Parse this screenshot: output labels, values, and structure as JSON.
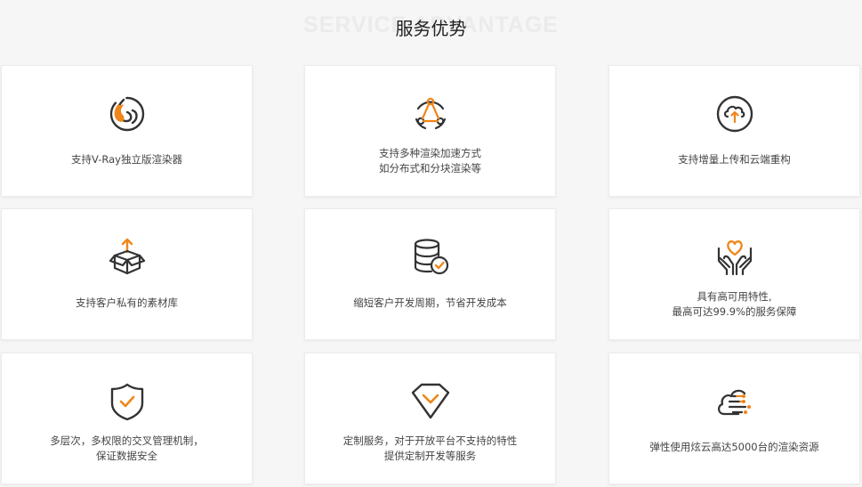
{
  "header": {
    "title": "服务优势",
    "bg_title": "SERVICE ADVANTAGE"
  },
  "colors": {
    "accent": "#f08519",
    "icon_dark": "#333333",
    "background": "#f6f6f6"
  },
  "cards": [
    {
      "icon": "vray-swirl-icon",
      "lines": [
        "支持V-Ray独立版渲染器"
      ]
    },
    {
      "icon": "triangle-nodes-icon",
      "lines": [
        "支持多种渲染加速方式",
        "如分布式和分块渲染等"
      ]
    },
    {
      "icon": "cloud-upload-icon",
      "lines": [
        "支持增量上传和云端重构"
      ]
    },
    {
      "icon": "box-upload-icon",
      "lines": [
        "支持客户私有的素材库"
      ]
    },
    {
      "icon": "database-check-icon",
      "lines": [
        "缩短客户开发周期，节省开发成本"
      ]
    },
    {
      "icon": "heart-hands-icon",
      "lines": [
        "具有高可用特性,",
        "最高可达99.9%的服务保障"
      ]
    },
    {
      "icon": "shield-check-icon",
      "lines": [
        "多层次，多权限的交叉管理机制，",
        "保证数据安全"
      ]
    },
    {
      "icon": "diamond-icon",
      "lines": [
        "定制服务，对于开放平台不支持的特性",
        "提供定制开发等服务"
      ]
    },
    {
      "icon": "cloud-network-icon",
      "lines": [
        "弹性使用炫云高达5000台的渲染资源"
      ]
    }
  ]
}
